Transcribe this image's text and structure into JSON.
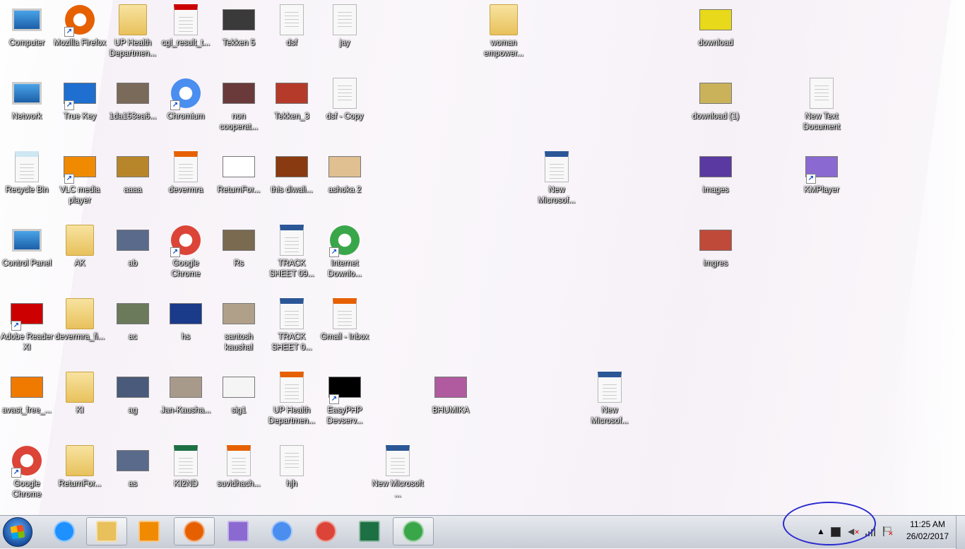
{
  "desktop": {
    "icons": [
      {
        "label": "Computer",
        "icon": "computer-icon",
        "shape": "monitor",
        "color": "#2b7cd3",
        "col": 0,
        "row": 0,
        "shortcut": false
      },
      {
        "label": "Mozilla Firefox",
        "icon": "firefox-icon",
        "shape": "circle",
        "color": "#e66000",
        "col": 1,
        "row": 0,
        "shortcut": true
      },
      {
        "label": "UP Health Departmen...",
        "icon": "folder-icon",
        "shape": "folder",
        "color": "#e8c15c",
        "col": 2,
        "row": 0,
        "shortcut": false
      },
      {
        "label": "cgl_result_t...",
        "icon": "pdf-icon",
        "shape": "doc",
        "color": "#cc0000",
        "col": 3,
        "row": 0,
        "shortcut": false
      },
      {
        "label": "Tekken 5",
        "icon": "game-image-icon",
        "shape": "img",
        "color": "#3a3a3a",
        "col": 4,
        "row": 0,
        "shortcut": false
      },
      {
        "label": "dsf",
        "icon": "text-file-icon",
        "shape": "doc",
        "color": "#f8f8f8",
        "col": 5,
        "row": 0,
        "shortcut": false
      },
      {
        "label": "jay",
        "icon": "text-file-icon",
        "shape": "doc",
        "color": "#f8f8f8",
        "col": 6,
        "row": 0,
        "shortcut": false
      },
      {
        "label": "woman empower...",
        "icon": "folder-icon",
        "shape": "folder",
        "color": "#e8c15c",
        "col": 9,
        "row": 0,
        "shortcut": false
      },
      {
        "label": "download",
        "icon": "image-icon",
        "shape": "img",
        "color": "#e8d91a",
        "col": 13,
        "row": 0,
        "shortcut": false
      },
      {
        "label": "Network",
        "icon": "network-icon",
        "shape": "monitor",
        "color": "#2b7cd3",
        "col": 0,
        "row": 1,
        "shortcut": false
      },
      {
        "label": "True Key",
        "icon": "truekey-icon",
        "shape": "img",
        "color": "#1e6fd0",
        "col": 1,
        "row": 1,
        "shortcut": true
      },
      {
        "label": "1da153ea6...",
        "icon": "image-icon",
        "shape": "img",
        "color": "#7a6a5a",
        "col": 2,
        "row": 1,
        "shortcut": false
      },
      {
        "label": "Chromium",
        "icon": "chromium-icon",
        "shape": "circle",
        "color": "#4a8ef0",
        "col": 3,
        "row": 1,
        "shortcut": true
      },
      {
        "label": "non cooperat...",
        "icon": "image-icon",
        "shape": "img",
        "color": "#6a3a3a",
        "col": 4,
        "row": 1,
        "shortcut": false
      },
      {
        "label": "Tekken_3",
        "icon": "image-icon",
        "shape": "img",
        "color": "#b53a2a",
        "col": 5,
        "row": 1,
        "shortcut": false
      },
      {
        "label": "dsf - Copy",
        "icon": "text-file-icon",
        "shape": "doc",
        "color": "#f8f8f8",
        "col": 6,
        "row": 1,
        "shortcut": false
      },
      {
        "label": "download (1)",
        "icon": "image-icon",
        "shape": "img",
        "color": "#c9b25a",
        "col": 13,
        "row": 1,
        "shortcut": false
      },
      {
        "label": "New Text Document",
        "icon": "text-file-icon",
        "shape": "doc",
        "color": "#f8f8f8",
        "col": 15,
        "row": 1,
        "shortcut": false
      },
      {
        "label": "Recycle Bin",
        "icon": "recycle-bin-icon",
        "shape": "doc",
        "color": "#cfe6f3",
        "col": 0,
        "row": 2,
        "shortcut": false
      },
      {
        "label": "VLC media player",
        "icon": "vlc-icon",
        "shape": "img",
        "color": "#f08a00",
        "col": 1,
        "row": 2,
        "shortcut": true
      },
      {
        "label": "aaaa",
        "icon": "image-icon",
        "shape": "img",
        "color": "#b8862a",
        "col": 2,
        "row": 2,
        "shortcut": false
      },
      {
        "label": "devermra",
        "icon": "firefox-html-icon",
        "shape": "doc",
        "color": "#e66000",
        "col": 3,
        "row": 2,
        "shortcut": false
      },
      {
        "label": "ReturnFor...",
        "icon": "window-icon",
        "shape": "img",
        "color": "#ffffff",
        "col": 4,
        "row": 2,
        "shortcut": false
      },
      {
        "label": "this diwali...",
        "icon": "image-icon",
        "shape": "img",
        "color": "#8a3a10",
        "col": 5,
        "row": 2,
        "shortcut": false
      },
      {
        "label": "ashoka 2",
        "icon": "image-icon",
        "shape": "img",
        "color": "#e0c090",
        "col": 6,
        "row": 2,
        "shortcut": false
      },
      {
        "label": "New Microsof...",
        "icon": "word-doc-icon",
        "shape": "doc",
        "color": "#2b5797",
        "col": 10,
        "row": 2,
        "shortcut": false
      },
      {
        "label": "images",
        "icon": "image-icon",
        "shape": "img",
        "color": "#5a3aa0",
        "col": 13,
        "row": 2,
        "shortcut": false
      },
      {
        "label": "KMPlayer",
        "icon": "kmplayer-icon",
        "shape": "img",
        "color": "#8a6ad0",
        "col": 15,
        "row": 2,
        "shortcut": true
      },
      {
        "label": "Control Panel",
        "icon": "control-panel-icon",
        "shape": "monitor",
        "color": "#2b9de0",
        "col": 0,
        "row": 3,
        "shortcut": false
      },
      {
        "label": "AK",
        "icon": "folder-icon",
        "shape": "folder",
        "color": "#e8c15c",
        "col": 1,
        "row": 3,
        "shortcut": false
      },
      {
        "label": "ab",
        "icon": "image-icon",
        "shape": "img",
        "color": "#5a6a8a",
        "col": 2,
        "row": 3,
        "shortcut": false
      },
      {
        "label": "Google Chrome",
        "icon": "chrome-icon",
        "shape": "circle",
        "color": "#db4437",
        "col": 3,
        "row": 3,
        "shortcut": true
      },
      {
        "label": "Rs",
        "icon": "image-icon",
        "shape": "img",
        "color": "#7a6a50",
        "col": 4,
        "row": 3,
        "shortcut": false
      },
      {
        "label": "TRACK SHEET 09...",
        "icon": "word-doc-icon",
        "shape": "doc",
        "color": "#2b5797",
        "col": 5,
        "row": 3,
        "shortcut": false
      },
      {
        "label": "Internet Downlo...",
        "icon": "idm-icon",
        "shape": "circle",
        "color": "#3aa64a",
        "col": 6,
        "row": 3,
        "shortcut": true
      },
      {
        "label": "imgres",
        "icon": "image-icon",
        "shape": "img",
        "color": "#c04a3a",
        "col": 13,
        "row": 3,
        "shortcut": false
      },
      {
        "label": "Adobe Reader XI",
        "icon": "adobe-reader-icon",
        "shape": "img",
        "color": "#cc0000",
        "col": 0,
        "row": 4,
        "shortcut": true
      },
      {
        "label": "devermra_fi...",
        "icon": "folder-icon",
        "shape": "folder",
        "color": "#e8c15c",
        "col": 1,
        "row": 4,
        "shortcut": false
      },
      {
        "label": "ac",
        "icon": "image-icon",
        "shape": "img",
        "color": "#6a7a5a",
        "col": 2,
        "row": 4,
        "shortcut": false
      },
      {
        "label": "hs",
        "icon": "image-icon",
        "shape": "img",
        "color": "#1a3a8a",
        "col": 3,
        "row": 4,
        "shortcut": false
      },
      {
        "label": "santosh kaushal",
        "icon": "image-icon",
        "shape": "img",
        "color": "#b0a08a",
        "col": 4,
        "row": 4,
        "shortcut": false
      },
      {
        "label": "TRACK SHEET 0...",
        "icon": "word-doc-icon",
        "shape": "doc",
        "color": "#2b5797",
        "col": 5,
        "row": 4,
        "shortcut": false
      },
      {
        "label": "Gmail - Inbox",
        "icon": "firefox-html-icon",
        "shape": "doc",
        "color": "#e66000",
        "col": 6,
        "row": 4,
        "shortcut": false
      },
      {
        "label": "avast_free_...",
        "icon": "avast-icon",
        "shape": "img",
        "color": "#f07a00",
        "col": 0,
        "row": 5,
        "shortcut": false
      },
      {
        "label": "KI",
        "icon": "folder-icon",
        "shape": "folder",
        "color": "#e8c15c",
        "col": 1,
        "row": 5,
        "shortcut": false
      },
      {
        "label": "ag",
        "icon": "image-icon",
        "shape": "img",
        "color": "#4a5a7a",
        "col": 2,
        "row": 5,
        "shortcut": false
      },
      {
        "label": "Jan-Kausha...",
        "icon": "image-icon",
        "shape": "img",
        "color": "#a89a8a",
        "col": 3,
        "row": 5,
        "shortcut": false
      },
      {
        "label": "sig1",
        "icon": "image-icon",
        "shape": "img",
        "color": "#f5f5f5",
        "col": 4,
        "row": 5,
        "shortcut": false
      },
      {
        "label": "UP Health Departmen...",
        "icon": "firefox-html-icon",
        "shape": "doc",
        "color": "#e66000",
        "col": 5,
        "row": 5,
        "shortcut": false
      },
      {
        "label": "EasyPHP Devserv...",
        "icon": "easyphp-icon",
        "shape": "img",
        "color": "#000000",
        "col": 6,
        "row": 5,
        "shortcut": true
      },
      {
        "label": "BHUMIKA",
        "icon": "image-icon",
        "shape": "img",
        "color": "#b05aa0",
        "col": 8,
        "row": 5,
        "shortcut": false
      },
      {
        "label": "New Microsof...",
        "icon": "word-doc-icon",
        "shape": "doc",
        "color": "#2b5797",
        "col": 11,
        "row": 5,
        "shortcut": false
      },
      {
        "label": "Google Chrome",
        "icon": "chrome-icon",
        "shape": "circle",
        "color": "#db4437",
        "col": 0,
        "row": 6,
        "shortcut": true
      },
      {
        "label": "ReturnFor...",
        "icon": "folder-icon",
        "shape": "folder",
        "color": "#e8c15c",
        "col": 1,
        "row": 6,
        "shortcut": false
      },
      {
        "label": "as",
        "icon": "image-icon",
        "shape": "img",
        "color": "#5a6a8a",
        "col": 2,
        "row": 6,
        "shortcut": false
      },
      {
        "label": "KI2ND",
        "icon": "excel-icon",
        "shape": "doc",
        "color": "#1d7044",
        "col": 3,
        "row": 6,
        "shortcut": false
      },
      {
        "label": "suvidhach...",
        "icon": "firefox-html-icon",
        "shape": "doc",
        "color": "#e66000",
        "col": 4,
        "row": 6,
        "shortcut": false
      },
      {
        "label": "hjh",
        "icon": "text-file-icon",
        "shape": "doc",
        "color": "#f8f8f8",
        "col": 5,
        "row": 6,
        "shortcut": false
      },
      {
        "label": "New Microsoft ...",
        "icon": "word-doc-icon",
        "shape": "doc",
        "color": "#2b5797",
        "col": 7,
        "row": 6,
        "shortcut": false
      }
    ]
  },
  "taskbar": {
    "start_label": "Start",
    "pinned": [
      {
        "name": "ie-icon",
        "color": "#1e90ff",
        "active": false
      },
      {
        "name": "file-explorer-icon",
        "color": "#e8c15c",
        "active": true
      },
      {
        "name": "media-player-icon",
        "color": "#f08a00",
        "active": false
      },
      {
        "name": "firefox-icon",
        "color": "#e66000",
        "active": true
      },
      {
        "name": "kmplayer-icon",
        "color": "#8a6ad0",
        "active": false
      },
      {
        "name": "chromium-icon",
        "color": "#4a8ef0",
        "active": false
      },
      {
        "name": "chrome-icon",
        "color": "#db4437",
        "active": false
      },
      {
        "name": "excel-icon",
        "color": "#1d7044",
        "active": false
      },
      {
        "name": "idm-icon",
        "color": "#3aa64a",
        "active": true
      }
    ],
    "tray": {
      "icons": [
        "show-hidden-icons-icon",
        "action-center-icon",
        "volume-muted-icon",
        "network-signal-icon",
        "flag-alert-icon"
      ]
    },
    "clock": {
      "time": "11:25 AM",
      "date": "26/02/2017"
    }
  }
}
